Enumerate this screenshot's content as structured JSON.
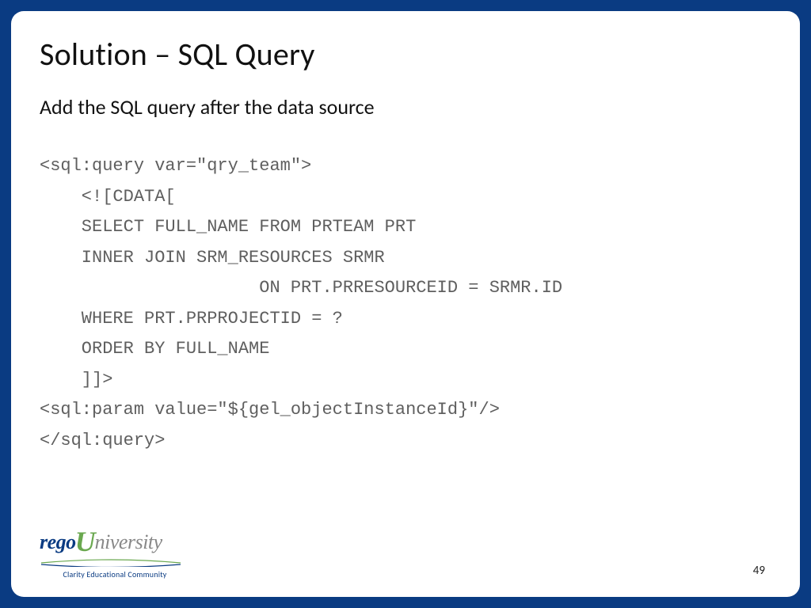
{
  "slide": {
    "title": "Solution – SQL Query",
    "subtitle": "Add the SQL query after the data source",
    "code": "<sql:query var=\"qry_team\">\n    <![CDATA[\n    SELECT FULL_NAME FROM PRTEAM PRT\n    INNER JOIN SRM_RESOURCES SRMR\n                     ON PRT.PRRESOURCEID = SRMR.ID\n    WHERE PRT.PRPROJECTID = ?\n    ORDER BY FULL_NAME\n    ]]>\n<sql:param value=\"${gel_objectInstanceId}\"/>\n</sql:query>"
  },
  "footer": {
    "logo_rego": "rego",
    "logo_u": "U",
    "logo_niversity": "niversity",
    "tagline": "Clarity Educational Community",
    "page_number": "49"
  }
}
